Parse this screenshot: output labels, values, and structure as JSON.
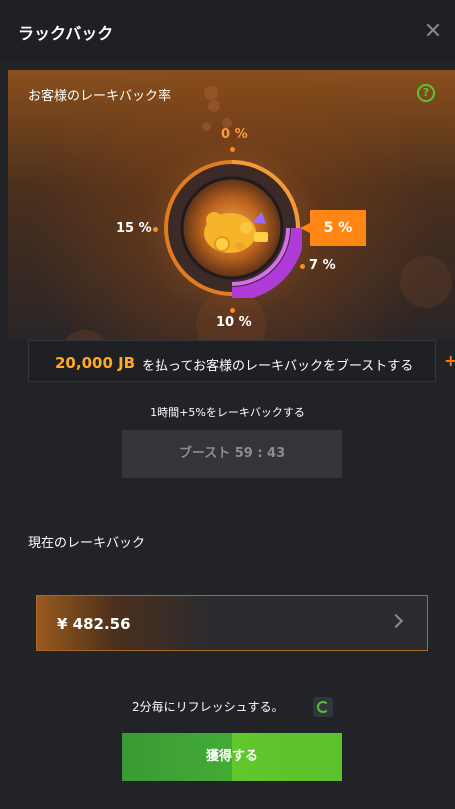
{
  "window": {
    "title": "ラックバック"
  },
  "hero": {
    "title": "お客様のレーキバック率",
    "help_symbol": "?",
    "levels": [
      {
        "label": "0 %",
        "id": "top"
      },
      {
        "label": "5 %",
        "id": "active"
      },
      {
        "label": "7 %",
        "id": "right"
      },
      {
        "label": "10 %",
        "id": "bottom"
      },
      {
        "label": "15 %",
        "id": "left"
      }
    ],
    "active_rate": "5 %",
    "accent_color": "#ff8514",
    "arc_color": "#b03bd8"
  },
  "boost": {
    "amount": "20,000 JB",
    "description": "を払ってお客様のレーキバックをブーストする",
    "plus_symbol": "+",
    "note": "1時間+5%をレーキバックする",
    "button_label": "ブースト 59 : 43"
  },
  "current": {
    "label": "現在のレーキバック",
    "amount": "¥ 482.56"
  },
  "refresh": {
    "text": "2分毎にリフレッシュする。"
  },
  "claim": {
    "button_label": "獲得する"
  }
}
